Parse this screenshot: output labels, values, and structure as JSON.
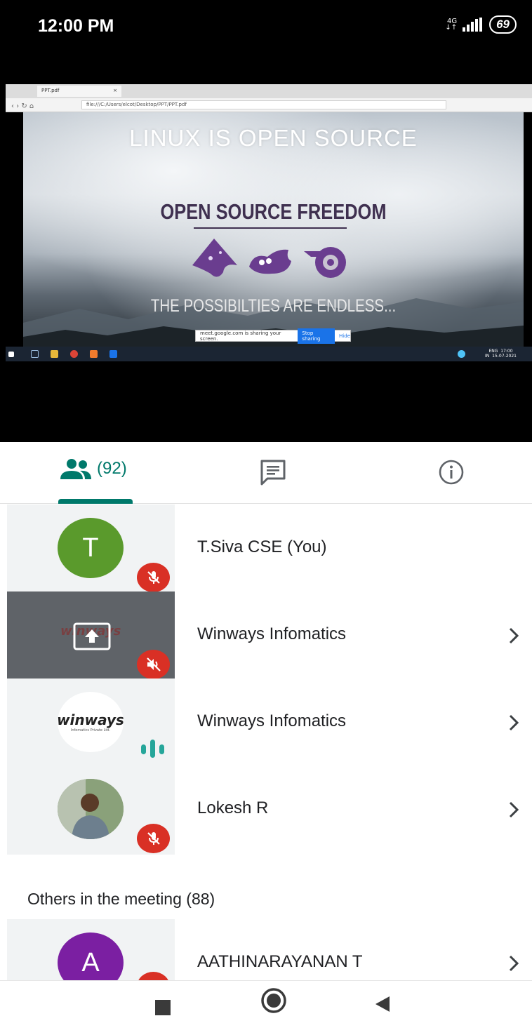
{
  "status_bar": {
    "time": "12:00 PM",
    "network": "4G",
    "battery": "69"
  },
  "shared_screen": {
    "browser_tab_title": "PPT.pdf",
    "url": "file:///C:/Users/elcot/Desktop/PPT/PPT.pdf",
    "slide": {
      "title": "LINUX IS OPEN SOURCE",
      "heading": "OPEN SOURCE FREEDOM",
      "tagline": "THE POSSIBILTIES ARE ENDLESS..."
    },
    "share_banner": {
      "message": "meet.google.com is sharing your screen.",
      "stop_label": "Stop sharing",
      "hide_label": "Hide"
    },
    "taskbar": {
      "lang_top": "ENG",
      "lang_bottom": "IN",
      "clock_time": "17:00",
      "clock_date": "15-07-2021"
    }
  },
  "tabs": {
    "people_count": "(92)",
    "people_icon": "people-icon",
    "chat_icon": "chat-icon",
    "info_icon": "info-icon"
  },
  "colors": {
    "accent": "#00796b",
    "mute": "#d93025",
    "avatar_t": "#5a9a2c",
    "avatar_a": "#7b1fa2",
    "speaking": "#26a69a"
  },
  "participants": [
    {
      "initial": "T",
      "name": "T.Siva CSE (You)",
      "status": "muted"
    },
    {
      "name": "Winways Infomatics",
      "status": "presenting-muted",
      "logo_text": "winways"
    },
    {
      "name": "Winways Infomatics",
      "status": "speaking",
      "logo_text": "winways",
      "logo_sub": "Infomatics Private Ltd."
    },
    {
      "name": "Lokesh R",
      "status": "muted"
    }
  ],
  "others": {
    "heading": "Others in the meeting (88)",
    "items": [
      {
        "initial": "A",
        "name": "AATHINARAYANAN T",
        "status": "muted"
      }
    ]
  },
  "nav_bar": {
    "icons": [
      "recents-icon",
      "home-icon",
      "back-icon"
    ]
  }
}
